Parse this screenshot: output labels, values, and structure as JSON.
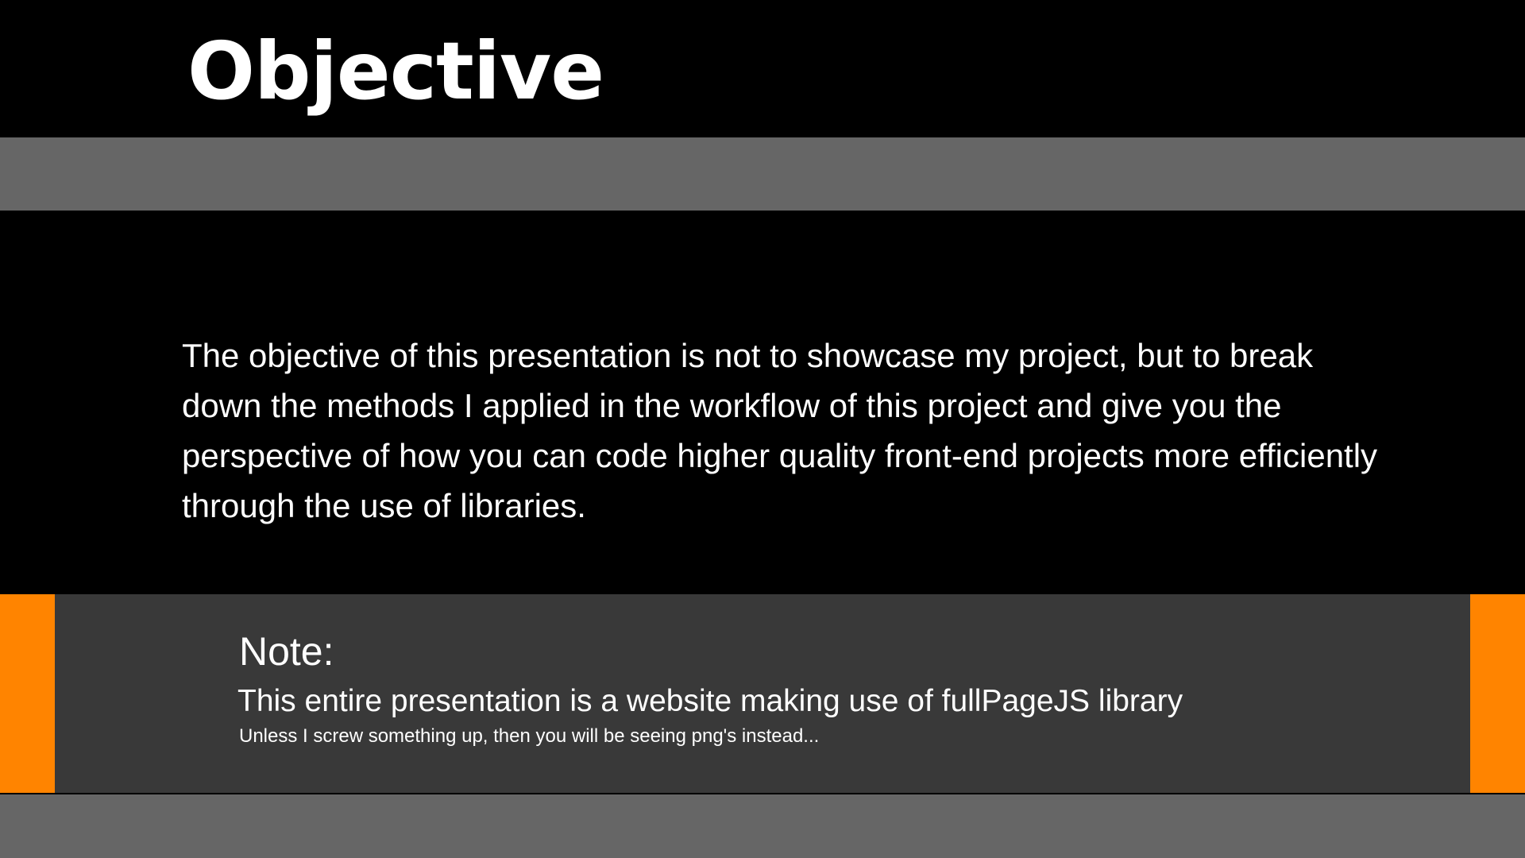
{
  "slide": {
    "title": "Objective",
    "body": "The objective of this presentation is not to showcase my project, but to break down the methods I applied in the workflow of this project and give you the perspective of how you can code higher quality front-end projects more efficiently through the use of libraries."
  },
  "note": {
    "label": "Note:",
    "line": "This entire presentation is a website making use of fullPageJS library",
    "subtext": "Unless I screw something up, then you will be seeing png's instead..."
  },
  "colors": {
    "background": "#000000",
    "band": "#666666",
    "panel": "#393939",
    "accent": "#ff8400",
    "text": "#ffffff"
  }
}
